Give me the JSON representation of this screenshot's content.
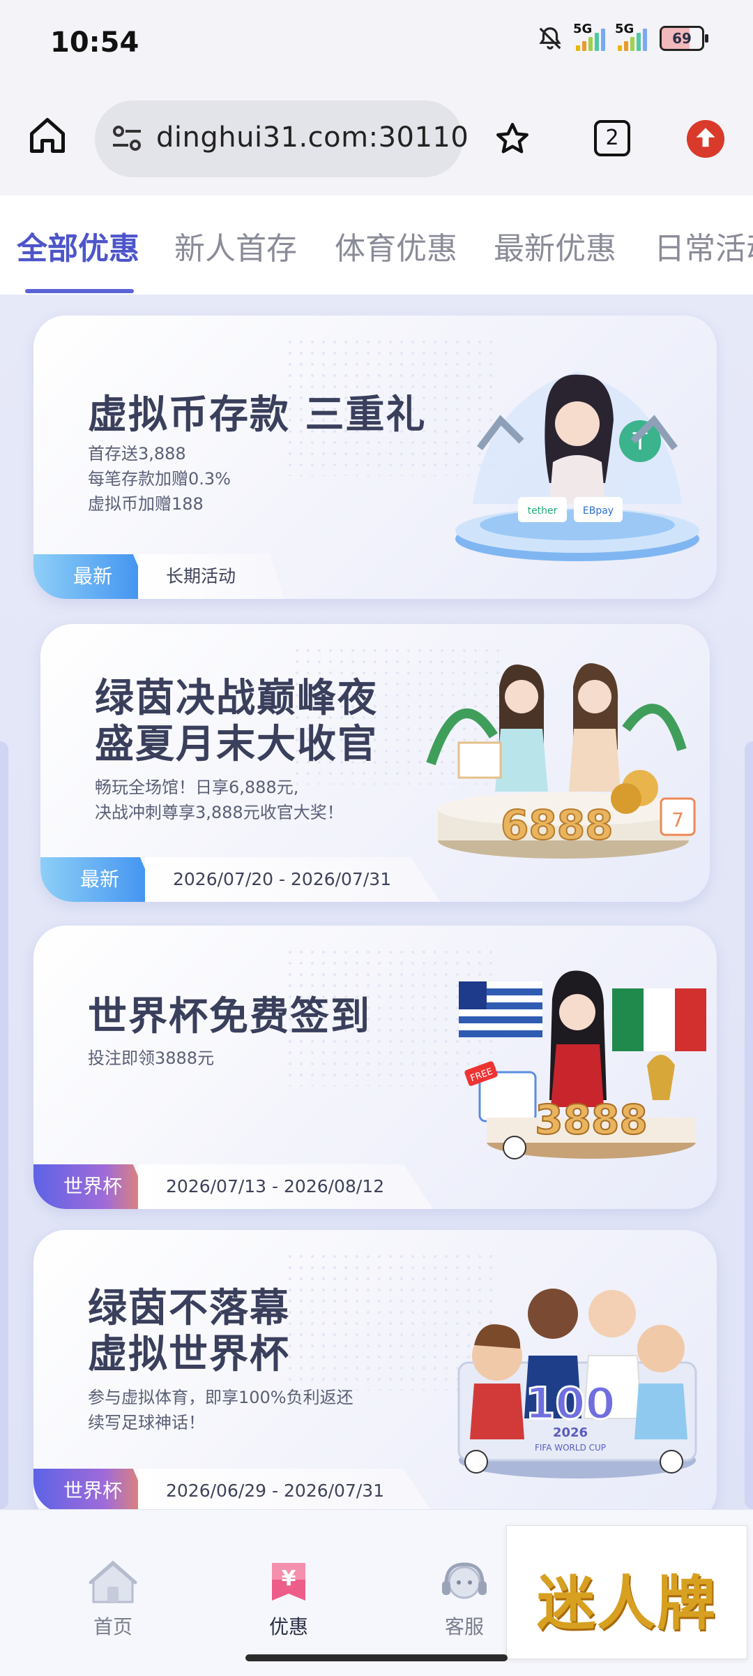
{
  "status_bar": {
    "time": "10:54",
    "signal_1": "5G",
    "signal_2": "5G",
    "battery": "69",
    "icons": [
      "mute-bell-icon",
      "signal-icon",
      "signal-icon",
      "battery-icon"
    ]
  },
  "browser": {
    "url": "dinghui31.com:30110",
    "tab_count": "2",
    "icons": [
      "home-icon",
      "site-settings-icon",
      "star-icon",
      "tabs-icon",
      "upload-icon"
    ]
  },
  "category_tabs": [
    {
      "label": "全部优惠",
      "active": true
    },
    {
      "label": "新人首存",
      "active": false
    },
    {
      "label": "体育优惠",
      "active": false
    },
    {
      "label": "最新优惠",
      "active": false
    },
    {
      "label": "日常活动",
      "active": false
    }
  ],
  "promos": [
    {
      "title": "虚拟币存款 三重礼",
      "desc": [
        "首存送3,888",
        "每笔存款加赠0.3%",
        "虚拟币加赠188"
      ],
      "tag": "最新",
      "period": "长期活动",
      "art_labels": [
        "tether",
        "EBpay"
      ]
    },
    {
      "title": "绿茵决战巅峰夜\n盛夏月末大收官",
      "desc": [
        "畅玩全场馆！日享6,888元,",
        "决战冲刺尊享3,888元收官大奖！"
      ],
      "tag": "最新",
      "period": "2026/07/20 - 2026/07/31",
      "art_labels": [
        "6888",
        "7"
      ]
    },
    {
      "title": "世界杯免费签到",
      "desc": [
        "投注即领3888元"
      ],
      "tag": "世界杯",
      "period": "2026/07/13 - 2026/08/12",
      "art_labels": [
        "3888",
        "FREE"
      ]
    },
    {
      "title": "绿茵不落幕\n虚拟世界杯",
      "desc": [
        "参与虚拟体育，即享100%负利返还",
        "续写足球神话！"
      ],
      "tag": "世界杯",
      "period": "2026/06/29 - 2026/07/31",
      "art_labels": [
        "100",
        "2026",
        "FIFA WORLD CUP"
      ]
    }
  ],
  "bottom_nav": [
    {
      "label": "首页",
      "icon": "home-icon",
      "active": false
    },
    {
      "label": "优惠",
      "icon": "yen-ticket-icon",
      "active": true
    },
    {
      "label": "客服",
      "icon": "headset-icon",
      "active": false
    }
  ],
  "brand": {
    "text": "迷人牌"
  },
  "colors": {
    "accent": "#4d55c9",
    "tag_new": "#3b8ef0",
    "tag_worldcup": "#9f6bd9"
  }
}
